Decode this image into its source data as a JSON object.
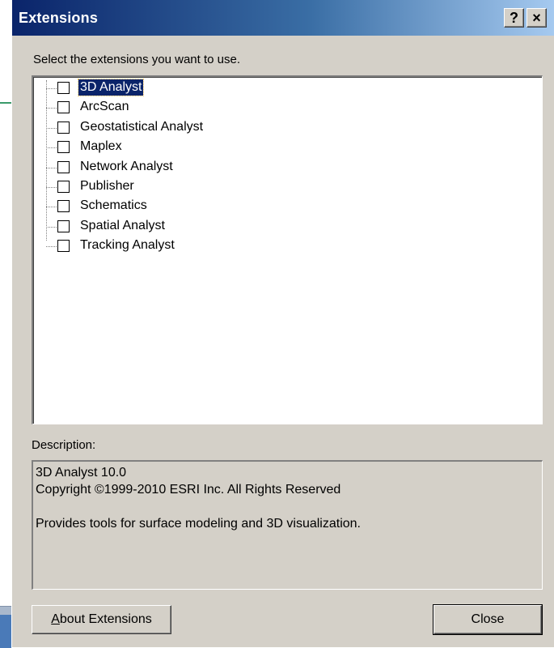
{
  "dialog": {
    "title": "Extensions",
    "help_glyph": "?",
    "close_glyph": "×",
    "prompt": "Select the extensions you want to use.",
    "extensions": [
      {
        "label": "3D Analyst",
        "checked": false,
        "selected": true
      },
      {
        "label": "ArcScan",
        "checked": false,
        "selected": false
      },
      {
        "label": "Geostatistical Analyst",
        "checked": false,
        "selected": false
      },
      {
        "label": "Maplex",
        "checked": false,
        "selected": false
      },
      {
        "label": "Network Analyst",
        "checked": false,
        "selected": false
      },
      {
        "label": "Publisher",
        "checked": false,
        "selected": false
      },
      {
        "label": "Schematics",
        "checked": false,
        "selected": false
      },
      {
        "label": "Spatial Analyst",
        "checked": false,
        "selected": false
      },
      {
        "label": "Tracking Analyst",
        "checked": false,
        "selected": false
      }
    ],
    "description_label": "Description:",
    "description": {
      "line1": "3D Analyst 10.0",
      "line2": "Copyright ©1999-2010 ESRI Inc. All Rights Reserved",
      "line3": "Provides tools for surface modeling and 3D visualization."
    },
    "about_button": {
      "accel": "A",
      "rest": "bout Extensions"
    },
    "close_button": "Close"
  },
  "colors": {
    "title_gradient_start": "#0a246a",
    "title_gradient_end": "#a6caf0",
    "face": "#d4d0c8",
    "selection": "#0a246a"
  }
}
